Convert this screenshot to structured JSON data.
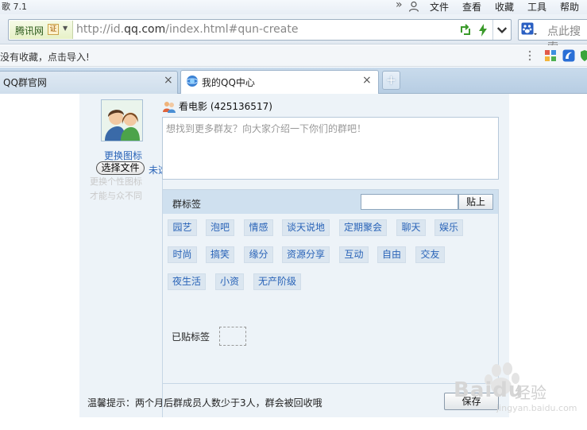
{
  "browser": {
    "title_fragment": "歌 7.1",
    "menu": [
      "»",
      "文件",
      "查看",
      "收藏",
      "工具",
      "帮助"
    ],
    "site_name": "腾讯网",
    "cert_label": "证",
    "url_host": "http://id.",
    "url_domain": "qq.com",
    "url_path": "/index.html#qun-create",
    "search_placeholder": "点此搜索",
    "favorites_text": "没有收藏，点击导入!",
    "tabs": [
      {
        "label": "QQ群官网",
        "close": "×"
      },
      {
        "label": "我的QQ中心",
        "close": "×"
      }
    ],
    "new_tab": "+"
  },
  "page": {
    "change_icon": "更换图标",
    "choose_file": "选择文件",
    "file_state": "未选择任何文件",
    "ghost_line1": "更换个性图标",
    "ghost_line2": "才能与众不同",
    "group_name": "看电影 (425136517)",
    "intro_placeholder": "想找到更多群友？向大家介绍一下你们的群吧！",
    "tags_title": "群标签",
    "tag_input_value": "",
    "tag_button": "贴上",
    "tags": [
      "园艺",
      "泡吧",
      "情感",
      "谈天说地",
      "定期聚会",
      "聊天",
      "娱乐",
      "时尚",
      "搞笑",
      "缘分",
      "资源分享",
      "互动",
      "自由",
      "交友",
      "夜生活",
      "小资",
      "无产阶级"
    ],
    "posted_label": "已贴标签",
    "tip": "温馨提示：两个月后群成员人数少于3人，群会被回收哦",
    "save_button": "保存"
  },
  "watermark": {
    "brand": "Baidu",
    "sub": "经验",
    "url": "jingyan.baidu.com"
  },
  "colors": {
    "link_blue": "#2a64b8",
    "panel_bg": "#edf3f8",
    "tab_bar": "#c0d4e8"
  }
}
